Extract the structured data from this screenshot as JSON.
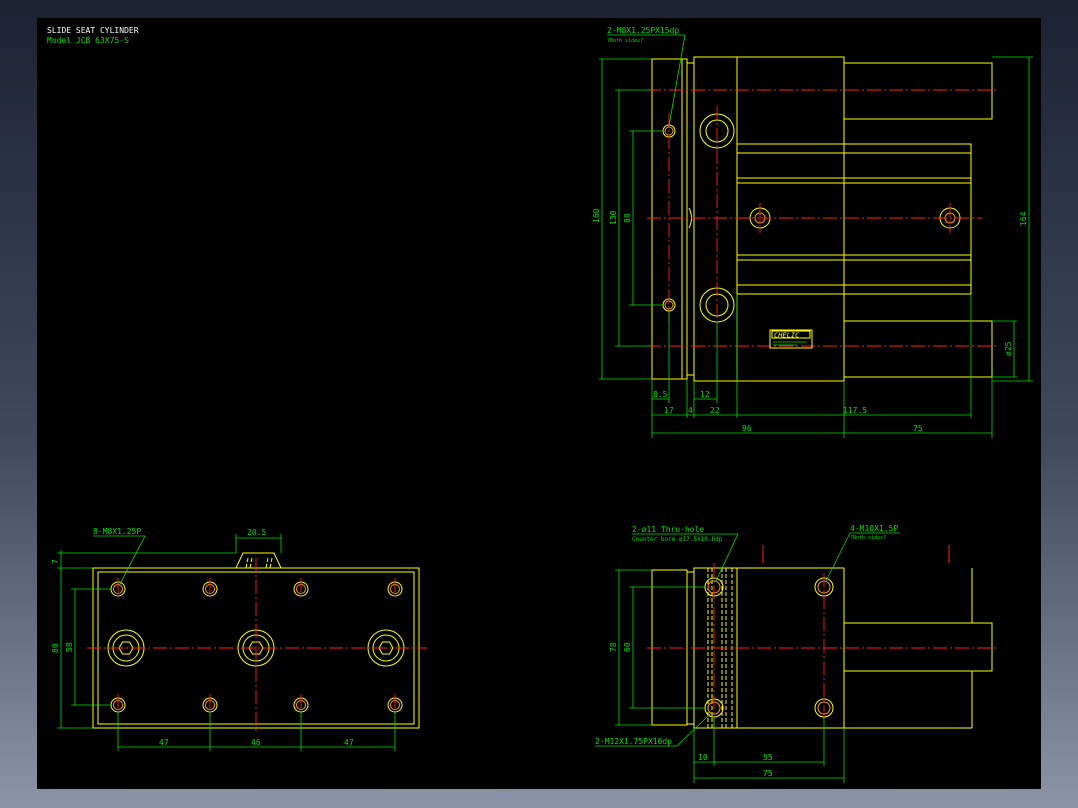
{
  "title": {
    "line1": "SLIDE SEAT CYLINDER",
    "line2": "Model  JCB 63X75-S"
  },
  "top_view": {
    "callout_thread": "2-M8X1.25PX15dp",
    "callout_both_sides": "?Both sides?",
    "brand_label": "CHELIC",
    "dims": {
      "h160": "160",
      "h130": "130",
      "h88": "88",
      "h164": "164",
      "dia25": "ø25",
      "d8_5": "8.5",
      "d12": "12",
      "d17": "17",
      "d4": "4",
      "d22": "22",
      "d117_5": "117.5",
      "d96": "96",
      "d75": "75"
    }
  },
  "bottom_left_view": {
    "callout_thread": "8-M8X1.25P",
    "dims": {
      "d20_5": "20.5",
      "d7": "7",
      "d80": "80",
      "d58": "58",
      "d47a": "47",
      "d46": "46",
      "d47b": "47"
    }
  },
  "bottom_right_view": {
    "callout_hole": "2-ø11  Thru-hole",
    "callout_counterbore": "Counter bore  ø17.5X10.8dp",
    "callout_m10": "4-M10X1.5P",
    "callout_m10_sides": "?Both sides?",
    "callout_m12": "2-M12X1.75PX16dp",
    "dims": {
      "d78": "78",
      "d60": "60",
      "d10": "10",
      "d55": "55",
      "d75": "75"
    }
  }
}
